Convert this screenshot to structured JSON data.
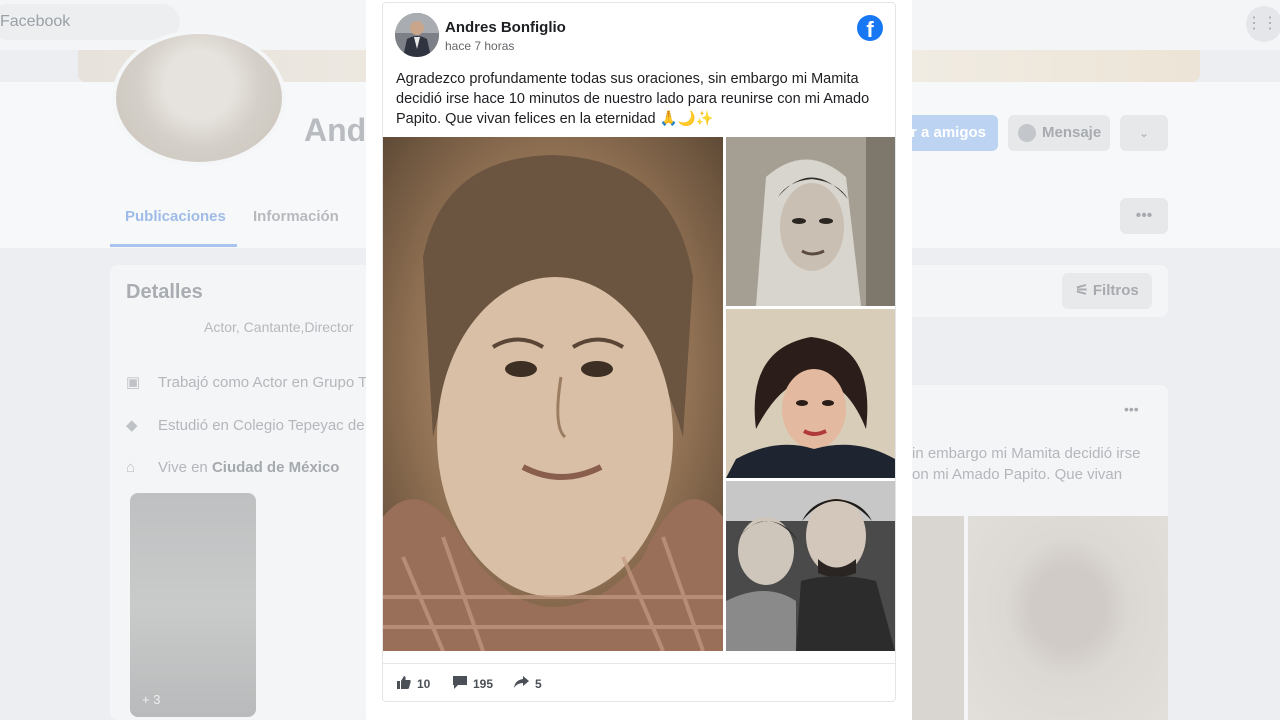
{
  "background": {
    "search_text": "Facebook",
    "profile_name_partial": "And",
    "add_friend_partial": "r a amigos",
    "message_label": "Mensaje",
    "tabs": [
      {
        "label": "Publicaciones",
        "active": true
      },
      {
        "label": "Información",
        "active": false
      }
    ],
    "details_title": "Detalles",
    "bio": "Actor, Cantante,Director",
    "details_lines": [
      {
        "icon": "briefcase-icon",
        "text": "Trabajó como Actor en Grupo T"
      },
      {
        "icon": "graduation-cap-icon",
        "text": "Estudió en Colegio Tepeyac de"
      },
      {
        "icon": "home-icon",
        "prefix": "Vive en ",
        "bold": "Ciudad de México"
      }
    ],
    "photo_more_count": "+ 3",
    "filters_label": "Filtros",
    "post_excerpt_line1": "in embargo mi Mamita decidió irse",
    "post_excerpt_line2": "on mi Amado Papito. Que vivan"
  },
  "post": {
    "author": "Andres Bonfiglio",
    "time": "hace 7 horas",
    "text": "Agradezco profundamente todas sus oraciones, sin embargo mi Mamita decidió irse hace 10 minutos de nuestro lado para reunirse con mi Amado Papito. Que vivan felices en la eternidad 🙏🌙✨",
    "logo_icon": "facebook-logo-icon",
    "reactions": {
      "likes": "10",
      "comments": "195",
      "shares": "5"
    },
    "accent_color": "#1877f2"
  }
}
